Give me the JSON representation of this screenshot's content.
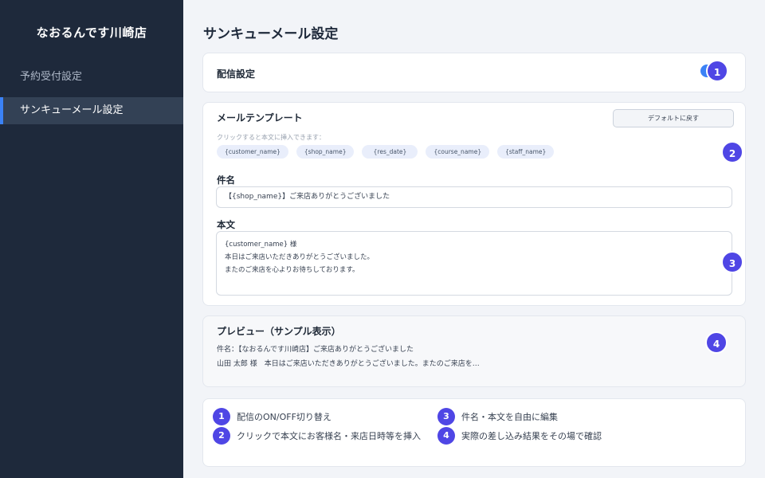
{
  "sidebar": {
    "brand": "なおるんです川崎店",
    "items": [
      {
        "label": "予約受付設定",
        "active": false
      },
      {
        "label": "サンキューメール設定",
        "active": true
      }
    ]
  },
  "page": {
    "title": "サンキューメール設定"
  },
  "delivery": {
    "title": "配信設定",
    "enabled": true,
    "badge": "1"
  },
  "template": {
    "title": "メールテンプレート",
    "reset_label": "デフォルトに戻す",
    "hint": "クリックすると本文に挿入できます：",
    "chips": [
      "{customer_name}",
      "{shop_name}",
      "{res_date}",
      "{course_name}",
      "{staff_name}"
    ],
    "badge_chips": "2",
    "subject_label": "件名",
    "subject_value": "【{shop_name}】ご来店ありがとうございました",
    "body_label": "本文",
    "body_lines": [
      "{customer_name} 様",
      "本日はご来店いただきありがとうございました。",
      "またのご来店を心よりお待ちしております。"
    ],
    "badge_body": "3"
  },
  "preview": {
    "title": "プレビュー（サンプル表示）",
    "subject_line": "件名：【なおるんです川崎店】ご来店ありがとうございました",
    "body_line": "山田 太郎 様　本日はご来店いただきありがとうございました。またのご来店を…",
    "badge": "4"
  },
  "legend": [
    {
      "num": "1",
      "text": "配信のON/OFF切り替え"
    },
    {
      "num": "2",
      "text": "クリックで本文にお客様名・来店日時等を挿入"
    },
    {
      "num": "3",
      "text": "件名・本文を自由に編集"
    },
    {
      "num": "4",
      "text": "実際の差し込み結果をその場で確認"
    }
  ],
  "colors": {
    "sidebar": "#1e293b",
    "accent": "#3b82f6",
    "badge": "#4f46e5"
  }
}
